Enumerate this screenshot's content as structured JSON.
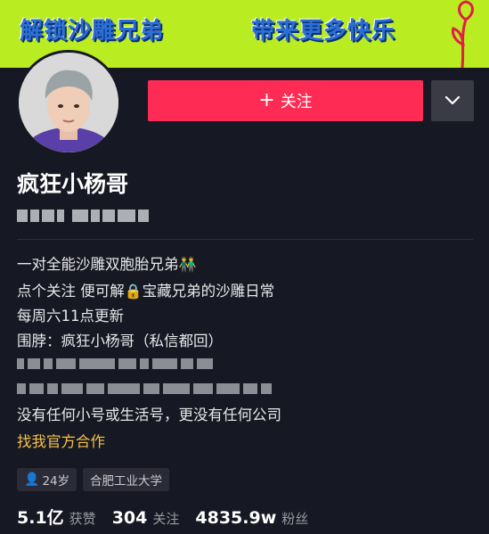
{
  "banner": {
    "left_text": "解锁沙雕兄弟",
    "right_text": "带来更多快乐"
  },
  "profile": {
    "follow_label": "关注",
    "name": "疯狂小杨哥"
  },
  "bio": {
    "line1": "一对全能沙雕双胞胎兄弟",
    "line2_a": "点个关注  便可解",
    "line2_b": "宝藏兄弟的沙雕日常",
    "line3": "每周六11点更新",
    "line4": "围脖：疯狂小杨哥（私信都回）",
    "line7": "没有任何小号或生活号，更没有任何公司",
    "link": "找我官方合作"
  },
  "tags": {
    "age": "24岁",
    "school": "合肥工业大学"
  },
  "stats": {
    "likes_value": "5.1亿",
    "likes_label": "获赞",
    "following_value": "304",
    "following_label": "关注",
    "fans_value": "4835.9w",
    "fans_label": "粉丝"
  },
  "colors": {
    "background": "#161823",
    "follow_button": "#fe2c55",
    "link": "#f4c24a",
    "banner": "#b9ec21"
  }
}
